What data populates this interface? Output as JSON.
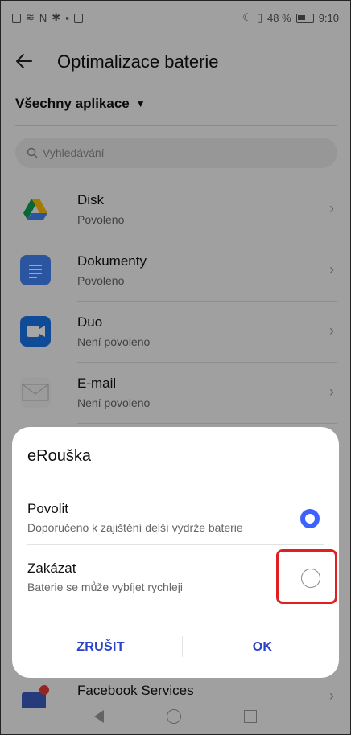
{
  "status": {
    "clock": "9:10",
    "battery": "48 %"
  },
  "appbar": {
    "title": "Optimalizace baterie"
  },
  "filter": {
    "label": "Všechny aplikace"
  },
  "search": {
    "placeholder": "Vyhledávání"
  },
  "apps": [
    {
      "name": "Disk",
      "status": "Povoleno"
    },
    {
      "name": "Dokumenty",
      "status": "Povoleno"
    },
    {
      "name": "Duo",
      "status": "Není povoleno"
    },
    {
      "name": "E-mail",
      "status": "Není povoleno"
    }
  ],
  "partial_app": {
    "name": "Facebook Services"
  },
  "dialog": {
    "title": "eRouška",
    "options": [
      {
        "title": "Povolit",
        "subtitle": "Doporučeno k zajištění delší výdrže baterie",
        "selected": true
      },
      {
        "title": "Zakázat",
        "subtitle": "Baterie se může vybíjet rychleji",
        "selected": false
      }
    ],
    "cancel": "ZRUŠIT",
    "ok": "OK"
  },
  "colors": {
    "accent": "#3d63ff",
    "button": "#2a43c8",
    "highlight": "#e02020"
  }
}
